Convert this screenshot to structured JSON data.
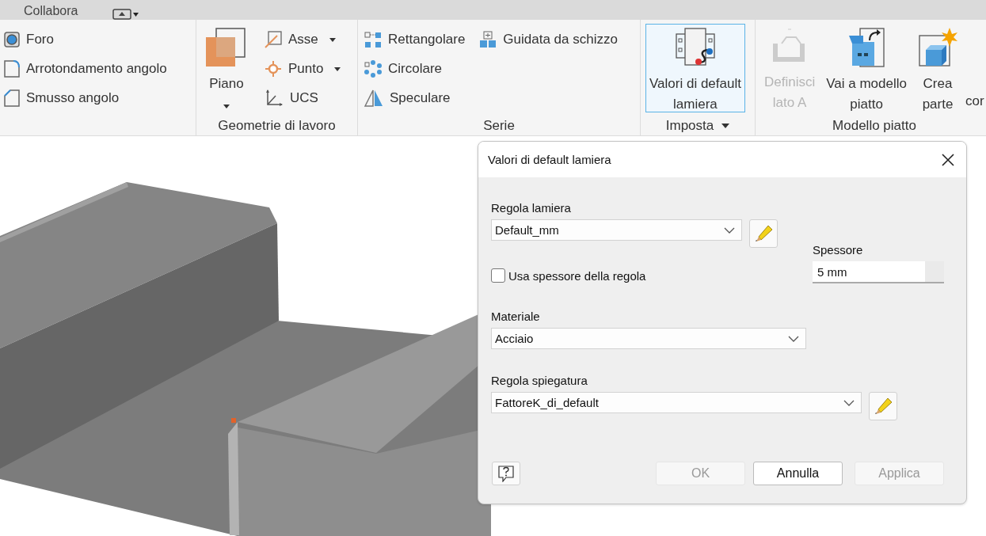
{
  "top_bar": {
    "tab_label": "Collabora"
  },
  "ribbon": {
    "panels": [
      {
        "columns": [
          [
            {
              "kind": "small",
              "label": "Foro",
              "dropdown": false,
              "disabled": false
            },
            {
              "kind": "small",
              "label": "Arrotondamento angolo",
              "dropdown": false,
              "disabled": false
            },
            {
              "kind": "small",
              "label": "Smusso angolo",
              "dropdown": false,
              "disabled": false
            }
          ]
        ]
      },
      {
        "label": "Geometrie di lavoro",
        "label_dropdown": false,
        "columns": [
          [
            {
              "kind": "large",
              "lines": [
                "Piano"
              ],
              "dropdown": true,
              "disabled": false,
              "highlighted": false
            }
          ],
          [
            {
              "kind": "small",
              "label": "Asse",
              "dropdown": true,
              "disabled": false
            },
            {
              "kind": "small",
              "label": "Punto",
              "dropdown": true,
              "disabled": false
            },
            {
              "kind": "small",
              "label": "UCS",
              "dropdown": false,
              "disabled": false
            }
          ]
        ]
      },
      {
        "label": "Serie",
        "label_dropdown": false,
        "columns": [
          [
            {
              "kind": "small",
              "label": "Rettangolare",
              "dropdown": false,
              "disabled": false
            },
            {
              "kind": "small",
              "label": "Circolare",
              "dropdown": false,
              "disabled": false
            },
            {
              "kind": "small",
              "label": "Speculare",
              "dropdown": false,
              "disabled": false
            }
          ],
          [
            {
              "kind": "small",
              "label": "Guidata da schizzo",
              "dropdown": false,
              "disabled": false
            }
          ]
        ]
      },
      {
        "label": "Imposta",
        "label_dropdown": true,
        "columns": [
          [
            {
              "kind": "large",
              "lines": [
                "Valori di default",
                "lamiera"
              ],
              "dropdown": false,
              "disabled": false,
              "highlighted": true
            }
          ]
        ]
      },
      {
        "label": "Modello piatto",
        "label_dropdown": false,
        "columns": [
          [
            {
              "kind": "large",
              "lines": [
                "Definisci",
                "lato A"
              ],
              "dropdown": false,
              "disabled": true,
              "highlighted": false
            }
          ],
          [
            {
              "kind": "large",
              "lines": [
                "Vai a modello",
                "piatto"
              ],
              "dropdown": false,
              "disabled": false,
              "highlighted": false
            }
          ],
          [
            {
              "kind": "large",
              "lines": [
                "Crea",
                "parte"
              ],
              "dropdown": false,
              "disabled": false,
              "highlighted": false
            }
          ],
          [
            {
              "kind": "clipped",
              "lines": [
                "cor"
              ],
              "dropdown": false,
              "disabled": false,
              "highlighted": false
            }
          ]
        ]
      }
    ]
  },
  "dialog": {
    "title": "Valori di default lamiera",
    "sheet_rule": {
      "label": "Regola lamiera",
      "value": "Default_mm"
    },
    "use_rule_thickness": {
      "label": "Usa spessore della regola",
      "checked": false
    },
    "thickness": {
      "label": "Spessore",
      "value": "5 mm"
    },
    "material": {
      "label": "Materiale",
      "value": "Acciaio"
    },
    "unfold_rule": {
      "label": "Regola spiegatura",
      "value": "FattoreK_di_default"
    },
    "buttons": [
      {
        "label": "OK",
        "disabled": true
      },
      {
        "label": "Annulla",
        "disabled": false
      },
      {
        "label": "Applica",
        "disabled": true
      }
    ]
  }
}
